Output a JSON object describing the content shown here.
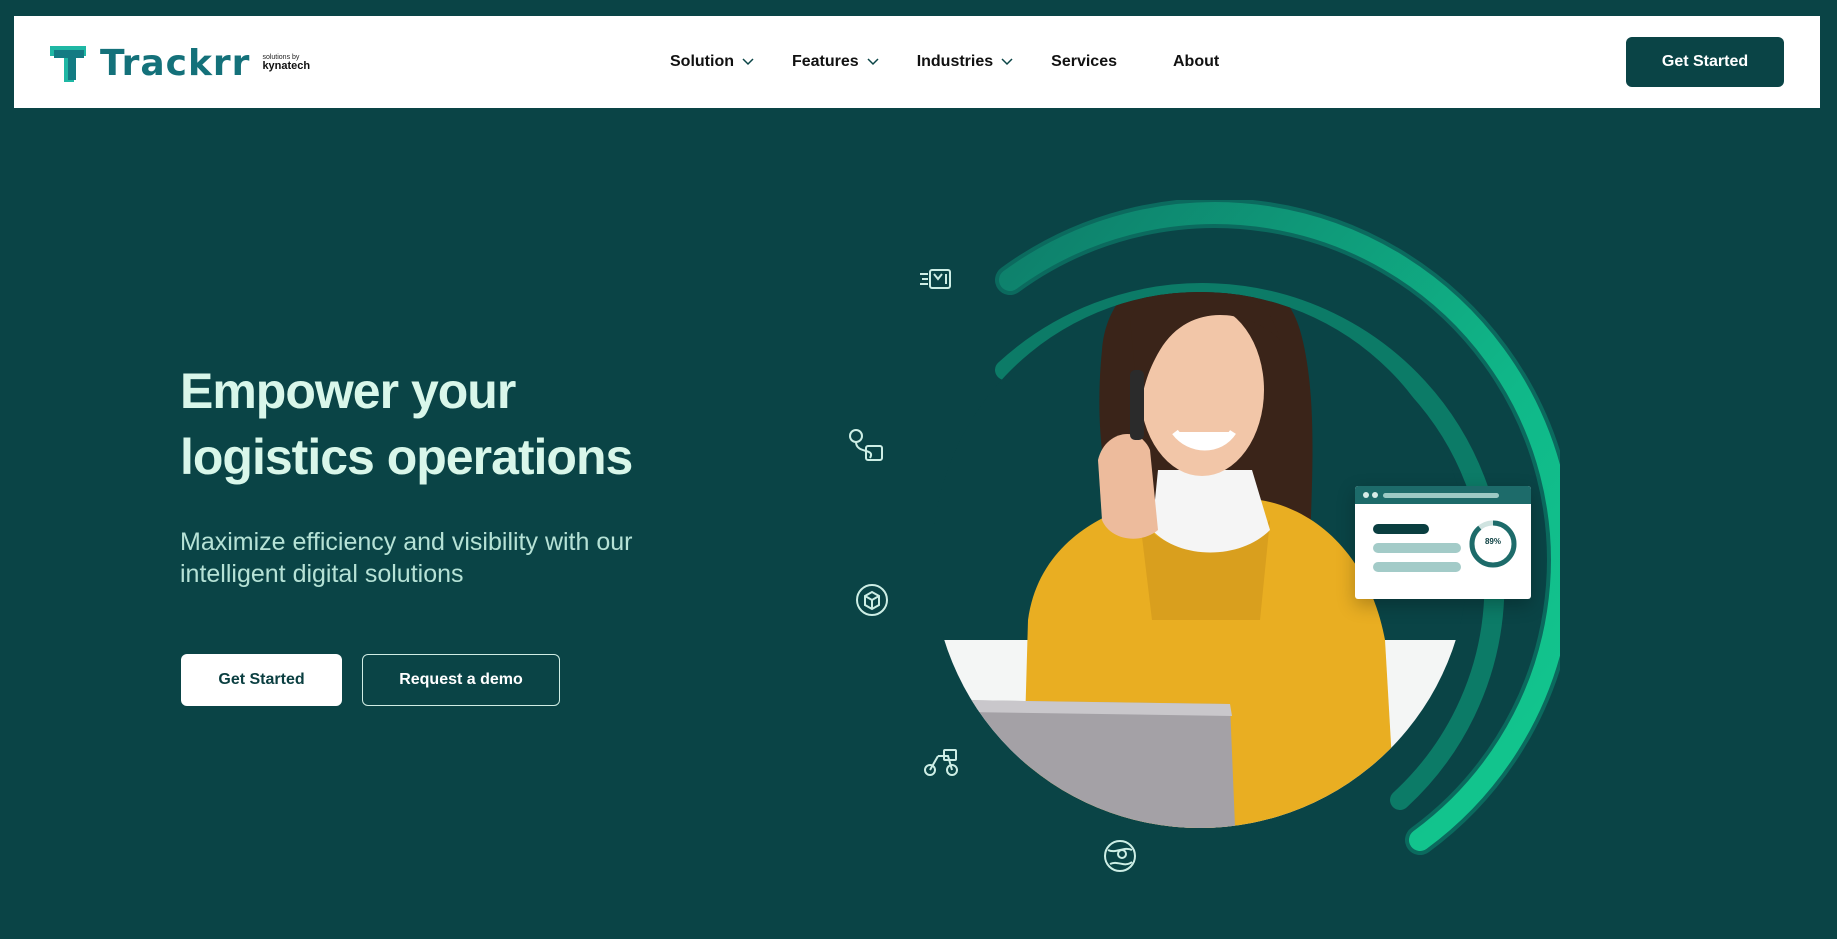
{
  "header": {
    "logo_text": "Trackrr",
    "logo_byline": "solutions by",
    "logo_partner": "kynatech",
    "nav": [
      {
        "label": "Solution",
        "has_dropdown": true
      },
      {
        "label": "Features",
        "has_dropdown": true
      },
      {
        "label": "Industries",
        "has_dropdown": true
      },
      {
        "label": "Services",
        "has_dropdown": false
      },
      {
        "label": "About",
        "has_dropdown": false
      }
    ],
    "cta_label": "Get Started"
  },
  "hero": {
    "title_line1": "Empower your",
    "title_line2": "logistics operations",
    "subtitle_line1": "Maximize efficiency and visibility with our",
    "subtitle_line2": "intelligent digital solutions",
    "primary_button": "Get Started",
    "secondary_button": "Request a demo"
  },
  "dashboard_card": {
    "percent_label": "89%",
    "progress": 0.89
  },
  "icons": [
    "parcel-fast-icon",
    "route-package-icon",
    "box-badge-icon",
    "scooter-delivery-icon",
    "global-location-icon",
    "chevron-down-icon"
  ],
  "colors": {
    "background": "#0a4446",
    "accent_green": "#0fb989",
    "logo_teal": "#14717a",
    "title_mint": "#d9f7ea",
    "jacket_yellow": "#e9ae22"
  }
}
